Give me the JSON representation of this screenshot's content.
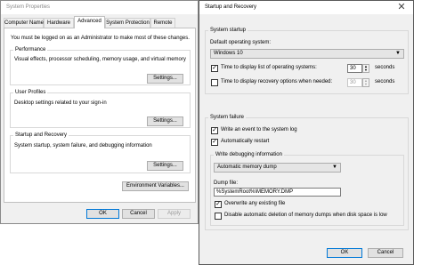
{
  "system_properties": {
    "title": "System Properties",
    "tabs": [
      "Computer Name",
      "Hardware",
      "Advanced",
      "System Protection",
      "Remote"
    ],
    "active_tab": "Advanced",
    "admin_notice": "You must be logged on as an Administrator to make most of these changes.",
    "performance": {
      "label": "Performance",
      "description": "Visual effects, processor scheduling, memory usage, and virtual memory",
      "settings_label": "Settings..."
    },
    "user_profiles": {
      "label": "User Profiles",
      "description": "Desktop settings related to your sign-in",
      "settings_label": "Settings..."
    },
    "startup_recovery": {
      "label": "Startup and Recovery",
      "description": "System startup, system failure, and debugging information",
      "settings_label": "Settings..."
    },
    "env_vars_label": "Environment Variables...",
    "ok_label": "OK",
    "cancel_label": "Cancel",
    "apply_label": "Apply"
  },
  "startup_recovery": {
    "title": "Startup and Recovery",
    "close_glyph": "✕",
    "system_startup": {
      "label": "System startup",
      "default_os_label": "Default operating system:",
      "default_os_value": "Windows 10",
      "time_display_os_label": "Time to display list of operating systems:",
      "time_display_os_checked": true,
      "time_display_os_value": "30",
      "time_display_os_unit": "seconds",
      "time_recovery_label": "Time to display recovery options when needed:",
      "time_recovery_checked": false,
      "time_recovery_value": "30",
      "time_recovery_unit": "seconds"
    },
    "system_failure": {
      "label": "System failure",
      "write_event_label": "Write an event to the system log",
      "write_event_checked": true,
      "auto_restart_label": "Automatically restart",
      "auto_restart_checked": true,
      "debug_info_label": "Write debugging information",
      "debug_info_value": "Automatic memory dump",
      "dump_file_label": "Dump file:",
      "dump_file_value": "%SystemRoot%\\MEMORY.DMP",
      "overwrite_label": "Overwrite any existing file",
      "overwrite_checked": true,
      "disable_auto_delete_label": "Disable automatic deletion of memory dumps when disk space is low",
      "disable_auto_delete_checked": false
    },
    "ok_label": "OK",
    "cancel_label": "Cancel"
  }
}
